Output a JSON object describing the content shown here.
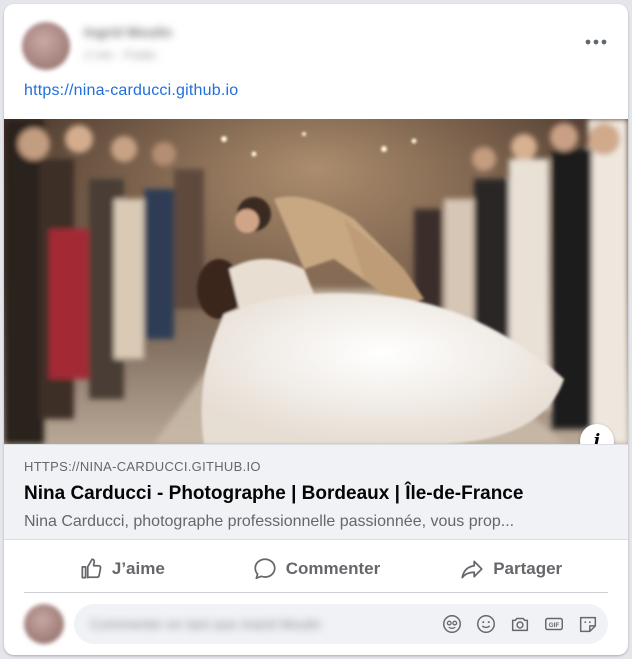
{
  "post": {
    "author_name": "Ingrid Moulin",
    "author_meta": "2 min · Public",
    "link_text": "https://nina-carducci.github.io"
  },
  "link_preview": {
    "domain": "HTTPS://NINA-CARDUCCI.GITHUB.IO",
    "title": "Nina Carducci - Photographe | Bordeaux | Île-de-France",
    "description": "Nina Carducci, photographe professionnelle passionnée, vous prop..."
  },
  "actions": {
    "like_label": "J’aime",
    "comment_label": "Commenter",
    "share_label": "Partager"
  },
  "comment_box": {
    "placeholder": "Commenter en tant que Ingrid Moulin"
  },
  "icons": {
    "more": "more-options-icon",
    "info": "info-icon",
    "like": "thumbs-up-icon",
    "comment": "speech-bubble-icon",
    "share": "share-arrow-icon",
    "comment_tools": [
      "avatar-sticker-icon",
      "emoji-icon",
      "camera-icon",
      "gif-icon",
      "sticker-icon"
    ]
  },
  "colors": {
    "link": "#216fdb",
    "secondary_text": "#65676b",
    "primary_text": "#050505",
    "meta_background": "#f0f2f5"
  }
}
